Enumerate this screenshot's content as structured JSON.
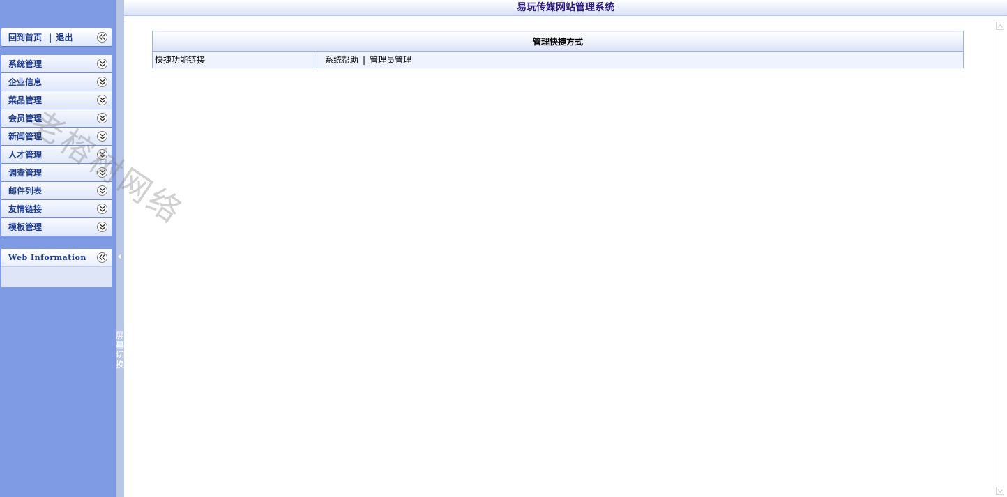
{
  "header": {
    "title": "易玩传媒网站管理系统"
  },
  "topnav": {
    "home": "回到首页",
    "separator": "|",
    "logout": "退出"
  },
  "sidebar": {
    "items": [
      {
        "label": "系统管理"
      },
      {
        "label": "企业信息"
      },
      {
        "label": "菜品管理"
      },
      {
        "label": "会员管理"
      },
      {
        "label": "新闻管理"
      },
      {
        "label": "人才管理"
      },
      {
        "label": "调查管理"
      },
      {
        "label": "邮件列表"
      },
      {
        "label": "友情链接"
      },
      {
        "label": "模板管理"
      }
    ],
    "info_title": "Web Information"
  },
  "splitter": {
    "toggle_text": "屏幕切换"
  },
  "quicklinks": {
    "header": "管理快捷方式",
    "row_label": "快捷功能链接",
    "link1": "系统帮助",
    "separator": "|",
    "link2": "管理员管理"
  },
  "watermark": "老榕树网络",
  "icons": {
    "collapse": "double-chevron-left-icon",
    "expand": "double-chevron-down-icon"
  },
  "colors": {
    "sidebar_bg": "#7f9be3",
    "title_text": "#2f1b80",
    "menu_text": "#1f3e92"
  }
}
